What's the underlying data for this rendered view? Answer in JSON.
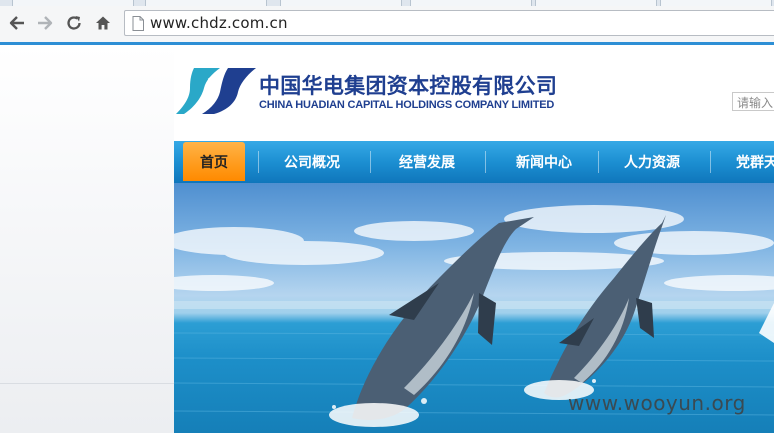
{
  "browser": {
    "url": "www.chdz.com.cn"
  },
  "header": {
    "company_name_cn": "中国华电集团资本控股有限公司",
    "company_name_en": "CHINA HUADIAN CAPITAL HOLDINGS COMPANY LIMITED",
    "search_placeholder": "请输入"
  },
  "nav": {
    "items": [
      {
        "label": "首页",
        "active": true
      },
      {
        "label": "公司概况"
      },
      {
        "label": "经营发展"
      },
      {
        "label": "新闻中心"
      },
      {
        "label": "人力资源"
      },
      {
        "label": "党群天"
      }
    ]
  },
  "banner": {
    "subject": "dolphins-jumping-over-sea"
  },
  "watermark": "www.wooyun.org",
  "colors": {
    "brand_blue": "#1f3f90",
    "nav_blue": "#1c8fd2",
    "active_orange": "#ff9a1a",
    "logo_teal": "#2aa8c8"
  }
}
